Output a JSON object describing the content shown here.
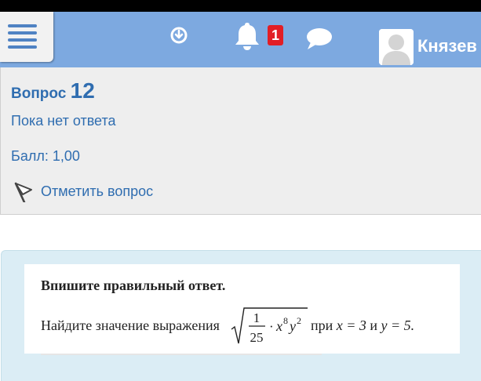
{
  "header": {
    "badge_count": "1",
    "username": "Князев"
  },
  "question_info": {
    "label": "Вопрос",
    "number": "12",
    "state": "Пока нет ответа",
    "grade": "Балл: 1,00",
    "flag_label": "Отметить вопрос"
  },
  "question": {
    "instruction": "Впишите правильный ответ.",
    "task_prefix": "Найдите значение выражения",
    "fraction_numerator": "1",
    "fraction_denominator": "25",
    "operator": "·",
    "var_x": "x",
    "exp_x": "8",
    "var_y": "y",
    "exp_y": "2",
    "word_at": "при",
    "x_eq": "x = 3",
    "word_and": "и",
    "y_eq": "y = 5."
  },
  "colors": {
    "navbar": "#7da9e0",
    "accent_text": "#2f6db0",
    "badge": "#e21e25",
    "question_bg": "#dbedf5"
  }
}
